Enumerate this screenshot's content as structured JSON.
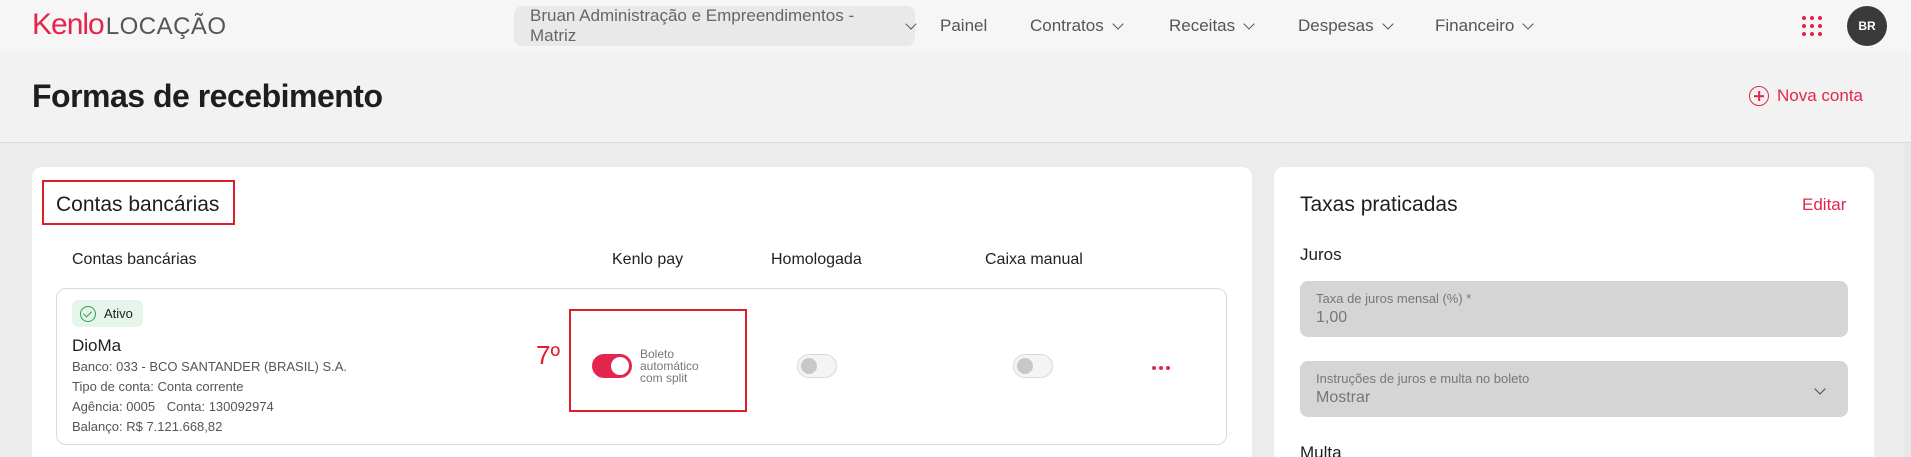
{
  "header": {
    "logo_brand": "Kenlo",
    "logo_product": "LOCAÇÃO",
    "company": "Bruan Administração e Empreendimentos - Matriz",
    "nav": {
      "painel": "Painel",
      "contratos": "Contratos",
      "receitas": "Receitas",
      "despesas": "Despesas",
      "financeiro": "Financeiro"
    },
    "avatar_initials": "BR"
  },
  "page": {
    "title": "Formas de recebimento",
    "new_account_label": "Nova conta"
  },
  "bank_accounts": {
    "section_title": "Contas bancárias",
    "columns": {
      "accounts": "Contas bancárias",
      "kenlo_pay": "Kenlo pay",
      "homologada": "Homologada",
      "caixa_manual": "Caixa manual"
    },
    "annotation_step": "7º",
    "account": {
      "status": "Ativo",
      "name": "DioMa",
      "bank_label": "Banco:",
      "bank": "033 - BCO SANTANDER (BRASIL) S.A.",
      "type_label": "Tipo de conta:",
      "type": "Conta corrente",
      "agency_label": "Agência:",
      "agency": "0005",
      "account_label": "Conta:",
      "account_number": "130092974",
      "balance_label": "Balanço:",
      "balance": "R$ 7.121.668,82",
      "kenlo_pay_on": true,
      "kenlo_pay_desc_1": "Boleto",
      "kenlo_pay_desc_2": "automático",
      "kenlo_pay_desc_3": "com split",
      "homologada_on": false,
      "caixa_manual_on": false
    }
  },
  "rates": {
    "title": "Taxas praticadas",
    "edit_label": "Editar",
    "juros_label": "Juros",
    "monthly_rate_label": "Taxa de juros mensal (%) *",
    "monthly_rate_value": "1,00",
    "instructions_label": "Instruções de juros e multa no boleto",
    "instructions_value": "Mostrar",
    "multa_label": "Multa"
  },
  "colors": {
    "brand": "#e4254d",
    "annotation": "#e01e2b"
  }
}
